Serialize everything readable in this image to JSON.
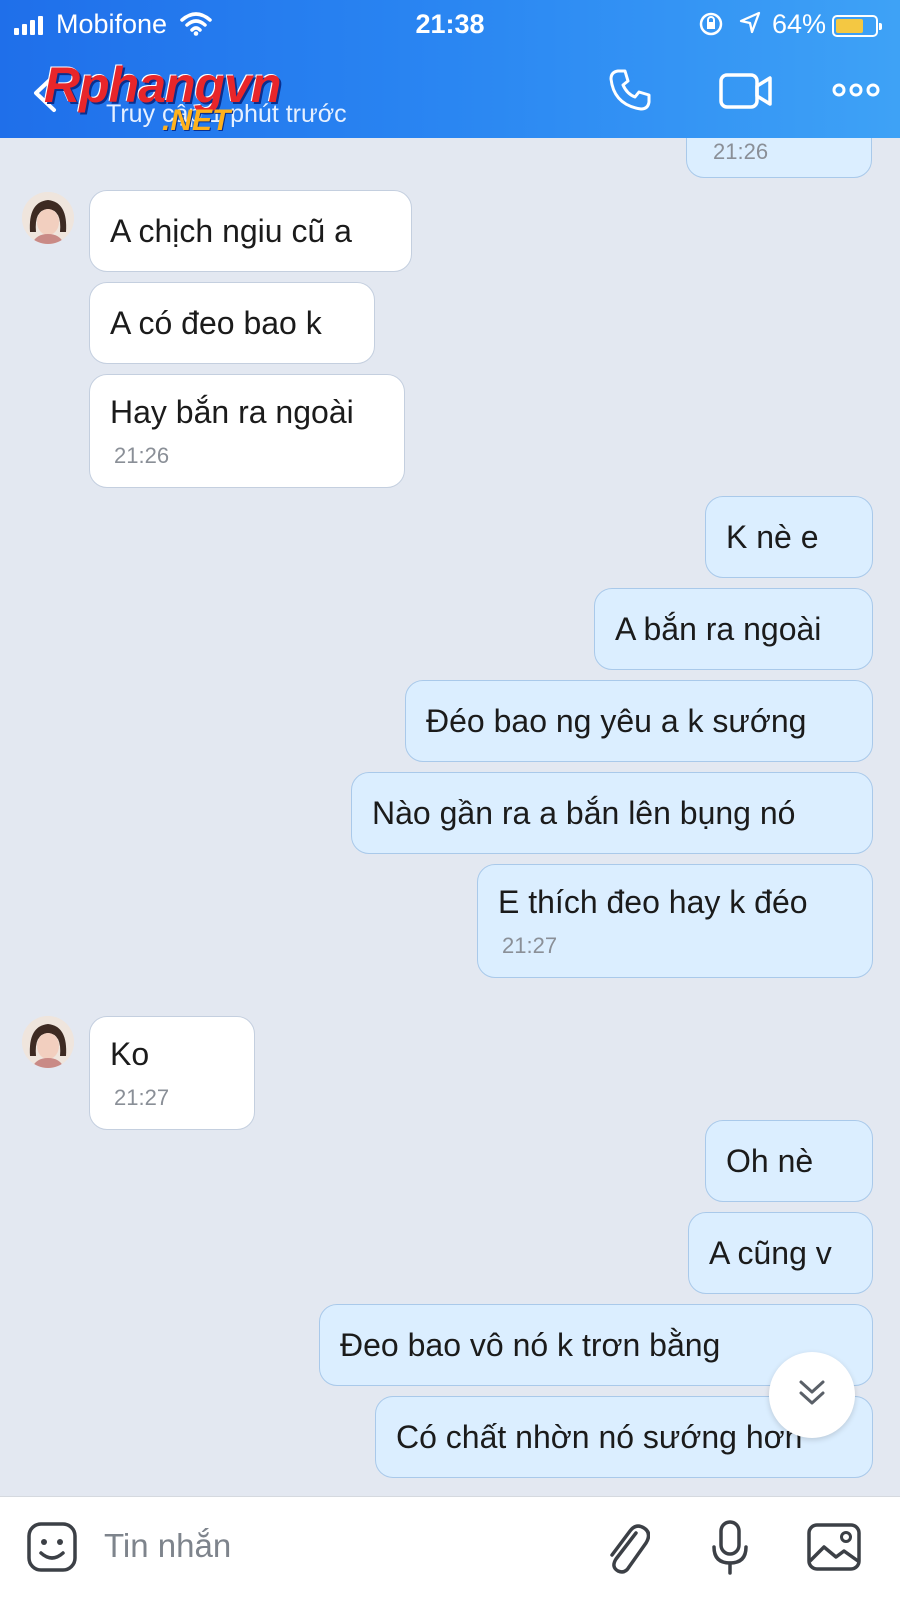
{
  "status_bar": {
    "carrier": "Mobifone",
    "time": "21:38",
    "battery": "64%",
    "battery_level": 0.64
  },
  "header": {
    "back_icon": "chevron-left-icon",
    "subtitle": "Truy cập 1 phút trước",
    "watermark": "Rphangvn",
    "watermark_suffix": ".NET",
    "icons": [
      "phone-icon",
      "video-camera-icon",
      "more-icon"
    ]
  },
  "messages": [
    {
      "side": "me",
      "text": "",
      "time": "21:26"
    },
    {
      "side": "them",
      "text": "A chịch ngiu cũ a",
      "avatar": true
    },
    {
      "side": "them",
      "text": "A có đeo bao k"
    },
    {
      "side": "them",
      "text": "Hay bắn ra ngoài",
      "time": "21:26"
    },
    {
      "side": "me",
      "text": "K nè e"
    },
    {
      "side": "me",
      "text": "A bắn ra ngoài"
    },
    {
      "side": "me",
      "text": "Đéo bao ng yêu a k sướng"
    },
    {
      "side": "me",
      "text": "Nào gần ra a bắn lên bụng nó"
    },
    {
      "side": "me",
      "text": "E thích đeo hay k đéo",
      "time": "21:27"
    },
    {
      "side": "them",
      "text": "Ko",
      "time": "21:27",
      "avatar": true
    },
    {
      "side": "me",
      "text": "Oh nè"
    },
    {
      "side": "me",
      "text": "A cũng v"
    },
    {
      "side": "me",
      "text": "Đeo bao vô nó k trơn bằng"
    },
    {
      "side": "me",
      "text": "Có chất nhờn nó sướng hơn"
    }
  ],
  "input": {
    "placeholder": "Tin nhắn",
    "icons": [
      "emoji-icon",
      "paperclip-icon",
      "microphone-icon",
      "image-icon"
    ]
  },
  "colors": {
    "header_gradient_start": "#1f6fea",
    "header_gradient_end": "#3ea2f6",
    "chat_background": "#e3e8f1",
    "my_bubble": "#dbeeff",
    "their_bubble": "#ffffff"
  }
}
